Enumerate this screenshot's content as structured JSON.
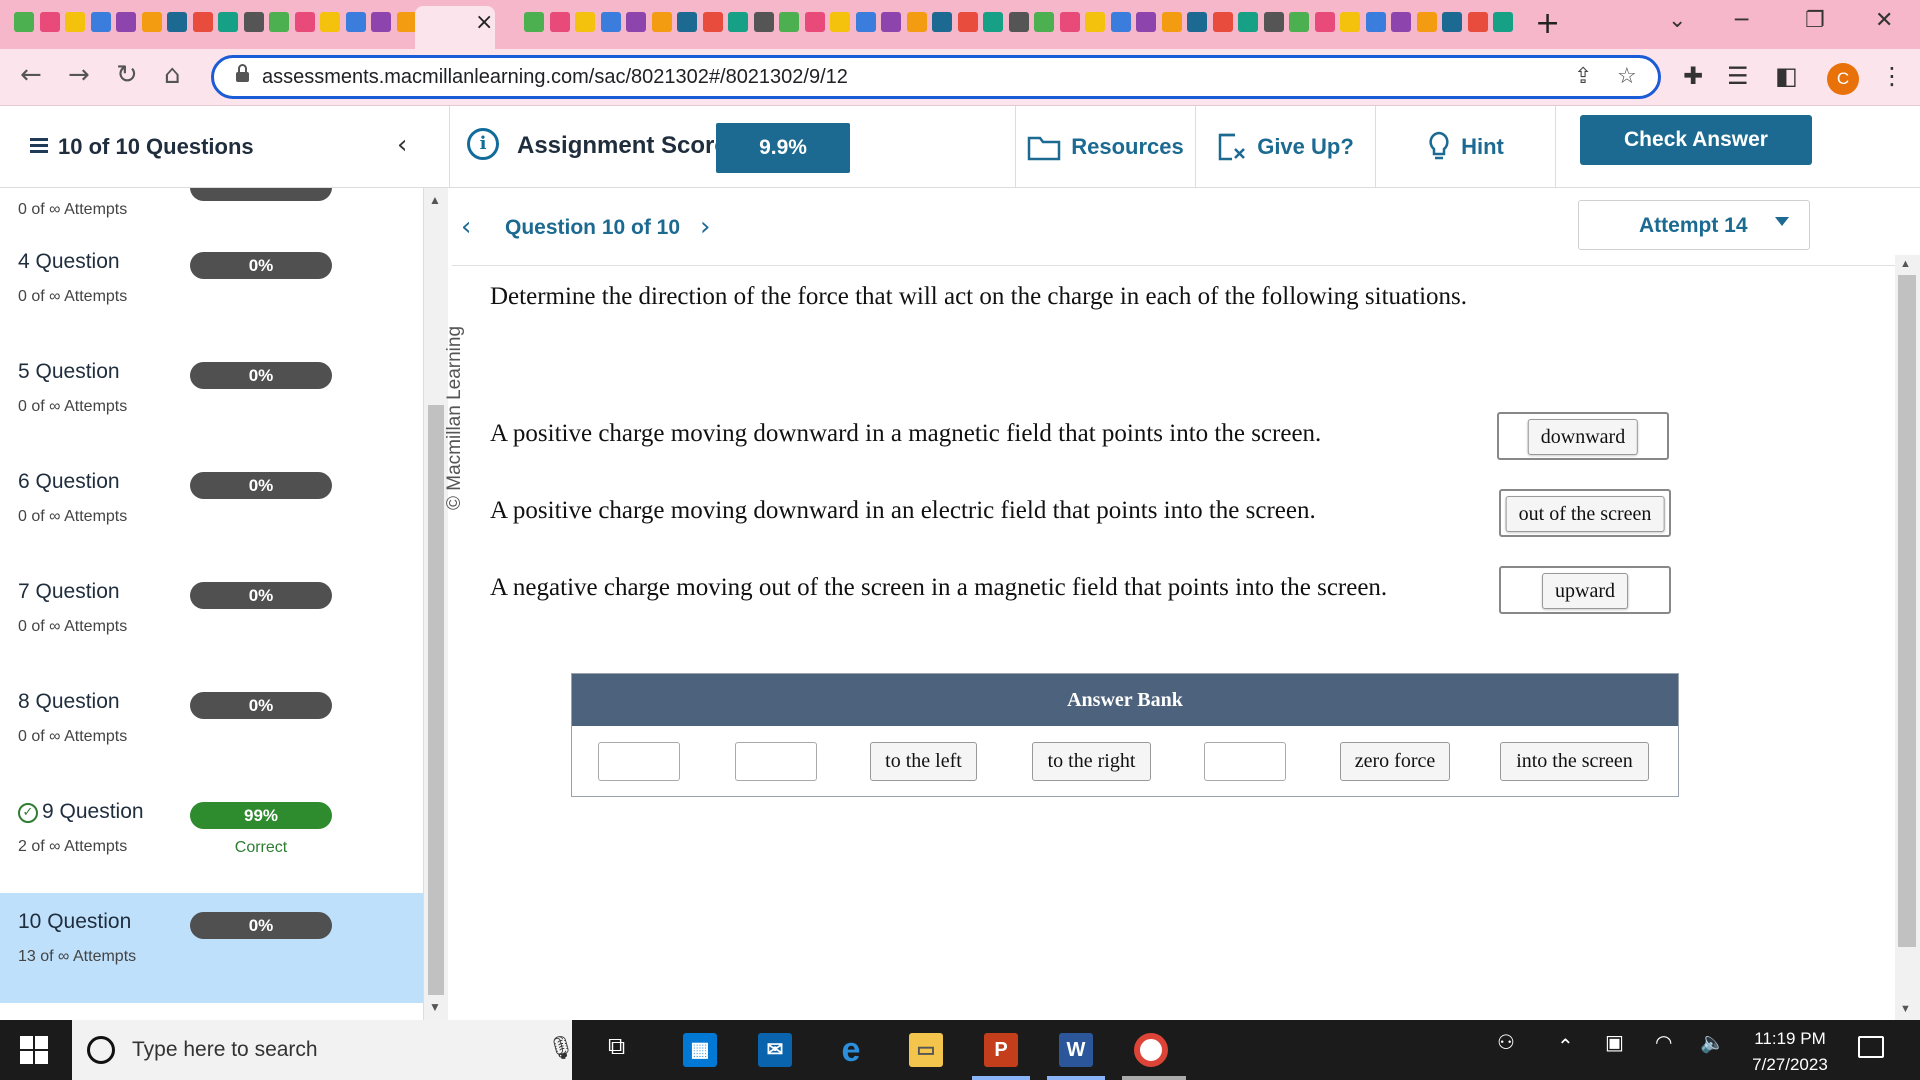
{
  "browser": {
    "tab_close": "×",
    "new_tab": "+",
    "url": "assessments.macmillanlearning.com/sac/8021302#/8021302/9/12",
    "profile_initial": "C",
    "tab_icon_colors": [
      "#4caf50",
      "#e84a7a",
      "#f4c20d",
      "#3b7ddd",
      "#8e44ad",
      "#f39c12",
      "#1c6a91",
      "#e74c3c",
      "#16a085",
      "#555555"
    ]
  },
  "header": {
    "question_count": "10 of 10 Questions",
    "score_label": "Assignment Score:",
    "score_value": "9.9%",
    "resources": "Resources",
    "give_up": "Give Up?",
    "hint": "Hint",
    "check_answer": "Check Answer"
  },
  "sidebar": {
    "top_partial_attempts": "0 of ∞ Attempts",
    "items": [
      {
        "title": "4 Question",
        "score": "0%",
        "attempts": "0 of ∞ Attempts"
      },
      {
        "title": "5 Question",
        "score": "0%",
        "attempts": "0 of ∞ Attempts"
      },
      {
        "title": "6 Question",
        "score": "0%",
        "attempts": "0 of ∞ Attempts"
      },
      {
        "title": "7 Question",
        "score": "0%",
        "attempts": "0 of ∞ Attempts"
      },
      {
        "title": "8 Question",
        "score": "0%",
        "attempts": "0 of ∞ Attempts"
      },
      {
        "title": "9 Question",
        "score": "99%",
        "attempts": "2 of ∞ Attempts",
        "status": "Correct"
      },
      {
        "title": "10 Question",
        "score": "0%",
        "attempts": "13 of ∞ Attempts"
      }
    ]
  },
  "question_nav": {
    "label": "Question 10 of 10",
    "attempt": "Attempt 14"
  },
  "question": {
    "copyright": "© Macmillan Learning",
    "prompt": "Determine the direction of the force that will act on the charge in each of the following situations.",
    "statements": [
      {
        "text": "A positive charge moving downward in a magnetic field that points into the screen.",
        "answer": "downward"
      },
      {
        "text": "A positive charge moving downward in an electric field that points into the screen.",
        "answer": "out of the screen"
      },
      {
        "text": "A negative charge moving out of the screen in a magnetic field that points into the screen.",
        "answer": "upward"
      }
    ]
  },
  "answer_bank": {
    "title": "Answer Bank",
    "items": [
      "",
      "",
      "to the left",
      "to the right",
      "",
      "zero force",
      "into the screen"
    ]
  },
  "taskbar": {
    "search_placeholder": "Type here to search",
    "time": "11:19 PM",
    "date": "7/27/2023"
  }
}
